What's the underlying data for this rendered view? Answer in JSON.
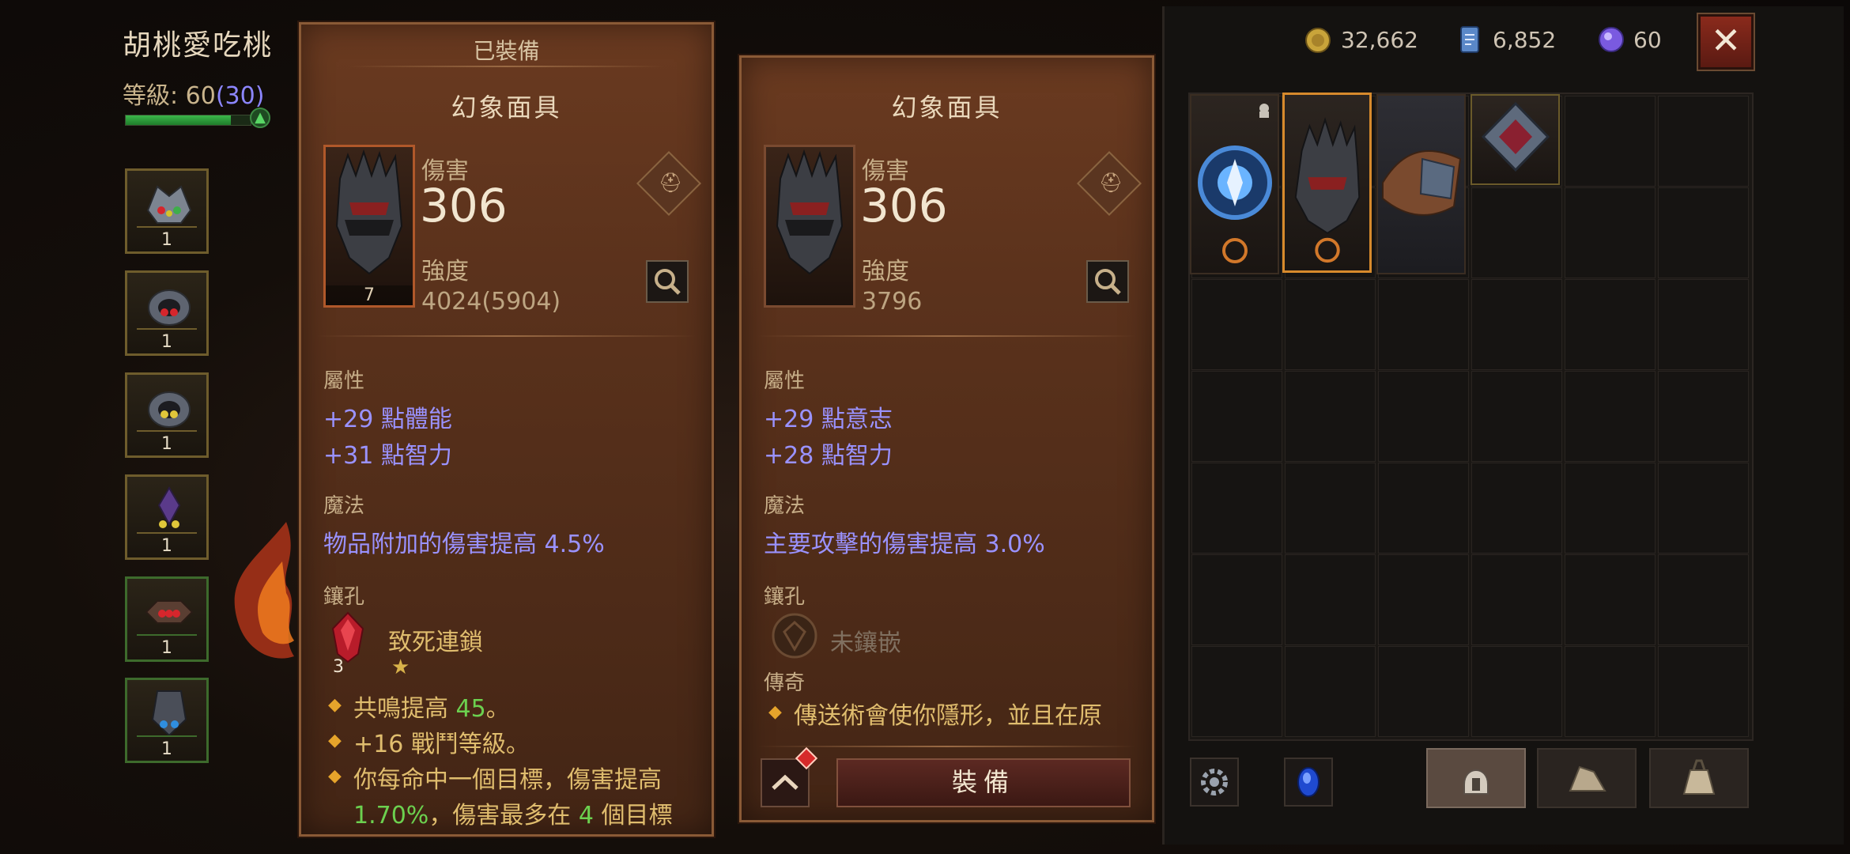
{
  "character": {
    "name": "胡桃愛吃桃",
    "level_label": "等級:",
    "level": "60",
    "paragon": "(30)",
    "xp_fraction": 0.84,
    "slots": [
      {
        "qty": "1",
        "icon": "helm-gear-icon"
      },
      {
        "qty": "1",
        "icon": "ring-gear-icon"
      },
      {
        "qty": "1",
        "icon": "ring-gear-icon"
      },
      {
        "qty": "1",
        "icon": "amulet-gear-icon"
      },
      {
        "qty": "1",
        "icon": "bracer-gear-icon"
      },
      {
        "qty": "1",
        "icon": "helm-gear-icon"
      }
    ]
  },
  "equipped_panel": {
    "header": "已裝備",
    "item_name": "幻象面具",
    "item_level": "7",
    "damage_label": "傷害",
    "damage": "306",
    "strength_label": "強度",
    "strength": "4024(5904)",
    "attr_label": "屬性",
    "attrs": [
      "+29 點體能",
      "+31 點智力"
    ],
    "magic_label": "魔法",
    "magic": "物品附加的傷害提高 4.5%",
    "socket_label": "鑲孔",
    "gem_name": "致死連鎖",
    "gem_rank": "3",
    "lines": {
      "l1_pre": "共鳴提高 ",
      "l1_val": "45",
      "l1_post": "。",
      "l2": "+16 戰鬥等級。",
      "l3": "你每命中一個目標，傷害提高",
      "l4_v1": "1.70%",
      "l4_mid": "，傷害最多在 ",
      "l4_v2": "4",
      "l4_post": " 個目標"
    }
  },
  "compare_panel": {
    "item_name": "幻象面具",
    "damage_label": "傷害",
    "damage": "306",
    "strength_label": "強度",
    "strength": "3796",
    "attr_label": "屬性",
    "attrs": [
      "+29 點意志",
      "+28 點智力"
    ],
    "magic_label": "魔法",
    "magic": "主要攻擊的傷害提高 3.0%",
    "socket_label": "鑲孔",
    "socket_empty": "未鑲嵌",
    "legend_label": "傳奇",
    "legend_text": "傳送術會使你隱形，並且在原",
    "equip_button": "裝備"
  },
  "inventory": {
    "currency": [
      {
        "icon": "gold-coin-icon",
        "value": "32,662"
      },
      {
        "icon": "scroll-icon",
        "value": "6,852"
      },
      {
        "icon": "orb-icon",
        "value": "60"
      }
    ]
  },
  "colors": {
    "magic_text": "#9a92ff",
    "highlight_green": "#6cd14f",
    "legend_gold": "#e0bd6e",
    "rarity_orange": "#d78a2c"
  }
}
